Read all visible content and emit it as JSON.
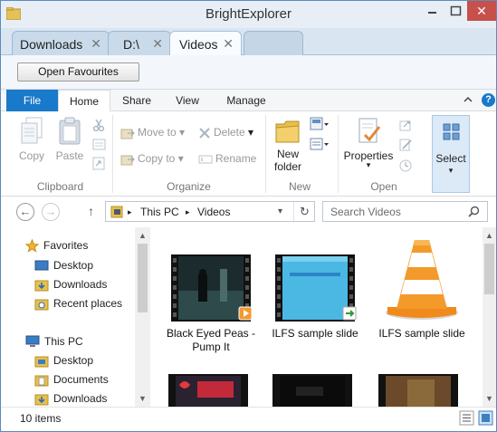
{
  "window": {
    "title": "BrightExplorer",
    "close_glyph": "✕",
    "minimize_icon": "minimize-icon",
    "maximize_icon": "maximize-icon"
  },
  "tabs": [
    {
      "label": "Downloads",
      "close": "✕"
    },
    {
      "label": "D:\\",
      "close": "✕"
    },
    {
      "label": "Videos",
      "close": "✕"
    }
  ],
  "favourites_button": "Open Favourites",
  "ribbon_tabs": {
    "file": "File",
    "home": "Home",
    "share": "Share",
    "view": "View",
    "manage": "Manage"
  },
  "ribbon": {
    "clipboard": {
      "label": "Clipboard",
      "copy": "Copy",
      "paste": "Paste"
    },
    "organize": {
      "label": "Organize",
      "move_to": "Move to",
      "copy_to": "Copy to",
      "delete": "Delete",
      "rename": "Rename"
    },
    "new": {
      "label": "New",
      "new_folder_line1": "New",
      "new_folder_line2": "folder"
    },
    "open": {
      "label": "Open",
      "properties": "Properties"
    },
    "select": {
      "label": "Select"
    }
  },
  "address": {
    "segments": [
      "This PC",
      "Videos"
    ],
    "search_placeholder": "Search Videos"
  },
  "nav_pane": {
    "favorites": "Favorites",
    "favorites_items": [
      "Desktop",
      "Downloads",
      "Recent places"
    ],
    "this_pc": "This PC",
    "this_pc_items": [
      "Desktop",
      "Documents",
      "Downloads"
    ]
  },
  "files": [
    {
      "name": "Black Eyed Peas - Pump It",
      "name_line1": "Black Eyed Peas -",
      "name_line2": "Pump It",
      "icon": "video-thumbnail"
    },
    {
      "name": "ILFS sample slide",
      "icon": "video-thumbnail"
    },
    {
      "name": "ILFS sample slide",
      "icon": "vlc-cone-icon"
    }
  ],
  "status": {
    "count": "10 items"
  },
  "colors": {
    "accent": "#1979ca",
    "close_button": "#c7504a"
  }
}
